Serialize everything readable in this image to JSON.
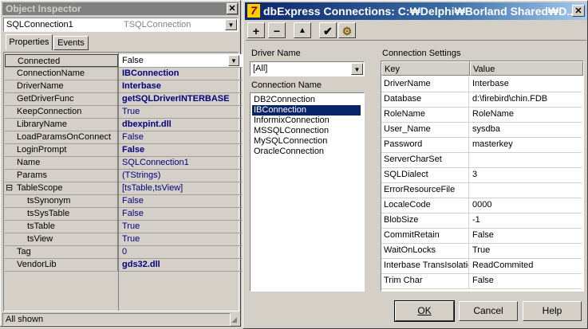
{
  "inspector": {
    "title": "Object Inspector",
    "close_glyph": "✕",
    "component_name": "SQLConnection1",
    "component_type": "TSQLConnection",
    "tabs": [
      "Properties",
      "Events"
    ],
    "status": "All shown",
    "properties": [
      {
        "name": "Connected",
        "value": "False",
        "bold": false,
        "selected": true
      },
      {
        "name": "ConnectionName",
        "value": "IBConnection",
        "bold": true
      },
      {
        "name": "DriverName",
        "value": "Interbase",
        "bold": true
      },
      {
        "name": "GetDriverFunc",
        "value": "getSQLDriverINTERBASE",
        "bold": true
      },
      {
        "name": "KeepConnection",
        "value": "True",
        "bold": false
      },
      {
        "name": "LibraryName",
        "value": "dbexpint.dll",
        "bold": true
      },
      {
        "name": "LoadParamsOnConnect",
        "value": "False",
        "bold": false
      },
      {
        "name": "LoginPrompt",
        "value": "False",
        "bold": true
      },
      {
        "name": "Name",
        "value": "SQLConnection1",
        "bold": false
      },
      {
        "name": "Params",
        "value": "(TStrings)",
        "bold": false
      },
      {
        "name": "TableScope",
        "value": "[tsTable,tsView]",
        "bold": false,
        "expander": "⊟"
      },
      {
        "name": "tsSynonym",
        "value": "False",
        "bold": false,
        "indent": true
      },
      {
        "name": "tsSysTable",
        "value": "False",
        "bold": false,
        "indent": true
      },
      {
        "name": "tsTable",
        "value": "True",
        "bold": false,
        "indent": true
      },
      {
        "name": "tsView",
        "value": "True",
        "bold": false,
        "indent": true
      },
      {
        "name": "Tag",
        "value": "0",
        "bold": false
      },
      {
        "name": "VendorLib",
        "value": "gds32.dll",
        "bold": true
      }
    ]
  },
  "dialog": {
    "title_icon": "7",
    "title": "dbExpress Connections: C:₩Delphi₩Borland Shared₩D...",
    "close_glyph": "✕",
    "toolbar": [
      "+",
      "−",
      "▲",
      "✔",
      "⚙"
    ],
    "driver_label": "Driver Name",
    "driver_value": "[All]",
    "conn_label": "Connection Name",
    "connections": [
      "DB2Connection",
      "IBConnection",
      "InformixConnection",
      "MSSQLConnection",
      "MySQLConnection",
      "OracleConnection"
    ],
    "selected_connection": 1,
    "settings_label": "Connection Settings",
    "col_key": "Key",
    "col_value": "Value",
    "settings": [
      {
        "key": "DriverName",
        "value": "Interbase"
      },
      {
        "key": "Database",
        "value": "d:\\firebird\\chin.FDB"
      },
      {
        "key": "RoleName",
        "value": "RoleName"
      },
      {
        "key": "User_Name",
        "value": "sysdba"
      },
      {
        "key": "Password",
        "value": "masterkey"
      },
      {
        "key": "ServerCharSet",
        "value": ""
      },
      {
        "key": "SQLDialect",
        "value": "3"
      },
      {
        "key": "ErrorResourceFile",
        "value": ""
      },
      {
        "key": "LocaleCode",
        "value": "0000"
      },
      {
        "key": "BlobSize",
        "value": "-1"
      },
      {
        "key": "CommitRetain",
        "value": "False"
      },
      {
        "key": "WaitOnLocks",
        "value": "True"
      },
      {
        "key": "Interbase TransIsolation",
        "value": "ReadCommited"
      },
      {
        "key": "Trim Char",
        "value": "False"
      }
    ],
    "ok_label": "OK",
    "cancel_label": "Cancel",
    "help_label": "Help"
  }
}
